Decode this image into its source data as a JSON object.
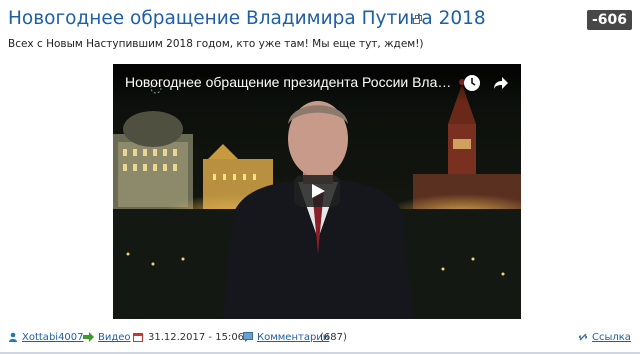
{
  "post": {
    "title": "Новогоднее обращение Владимира Путина 2018",
    "rating": "-606",
    "text": "Всех с Новым Наступившим 2018 годом, кто уже там! Мы еще тут, ждем!)"
  },
  "video": {
    "title": "Новогоднее обращение президента России Владим...",
    "icons": [
      "clock-icon",
      "share-icon",
      "play-icon"
    ]
  },
  "footer": {
    "author": "Xottabi4007",
    "category": "Видео",
    "date": "31.12.2017 - 15:06",
    "comments_label": "Комментарии",
    "comments_count": "(687)",
    "link_label": "Ссылка"
  },
  "colors": {
    "link": "#1f5fa8",
    "rating_bg": "#474747"
  }
}
